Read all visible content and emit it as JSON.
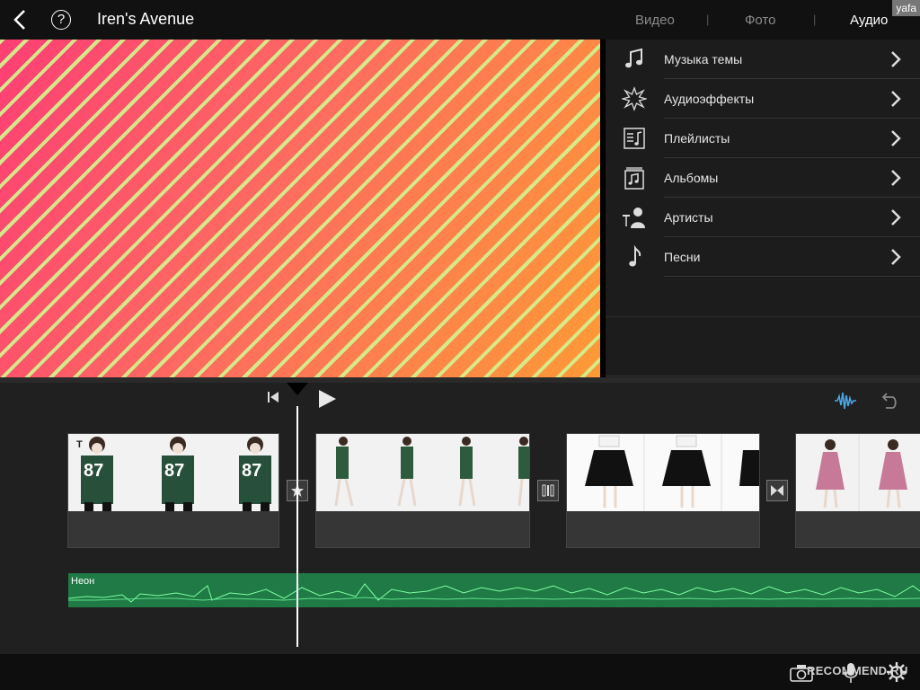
{
  "header": {
    "title": "Iren's Avenue",
    "help_symbol": "?",
    "tabs": [
      {
        "label": "Видео",
        "active": false
      },
      {
        "label": "Фото",
        "active": false
      },
      {
        "label": "Аудио",
        "active": true
      }
    ],
    "separator": "|",
    "watermark": "yafa"
  },
  "audio_menu": {
    "items": [
      {
        "label": "Музыка темы",
        "icon": "music-note-icon"
      },
      {
        "label": "Аудиоэффекты",
        "icon": "burst-icon"
      },
      {
        "label": "Плейлисты",
        "icon": "playlist-icon"
      },
      {
        "label": "Альбомы",
        "icon": "album-icon"
      },
      {
        "label": "Артисты",
        "icon": "artist-icon"
      },
      {
        "label": "Песни",
        "icon": "song-note-icon"
      }
    ]
  },
  "timeline": {
    "clips": [
      {
        "name": "clip-1",
        "has_title": true,
        "title_mark": "T"
      },
      {
        "name": "clip-2"
      },
      {
        "name": "clip-3"
      },
      {
        "name": "clip-4"
      }
    ],
    "transitions": [
      "star-transition-icon",
      "dissolve-transition-icon",
      "bowtie-transition-icon"
    ],
    "audio_track": {
      "label": "Неон",
      "color": "#1f7a45"
    }
  },
  "footer": {
    "brand": "RECOMMEND.RU"
  },
  "colors": {
    "accent_blue": "#4aa8e8",
    "waveform": "#7dffa0"
  }
}
